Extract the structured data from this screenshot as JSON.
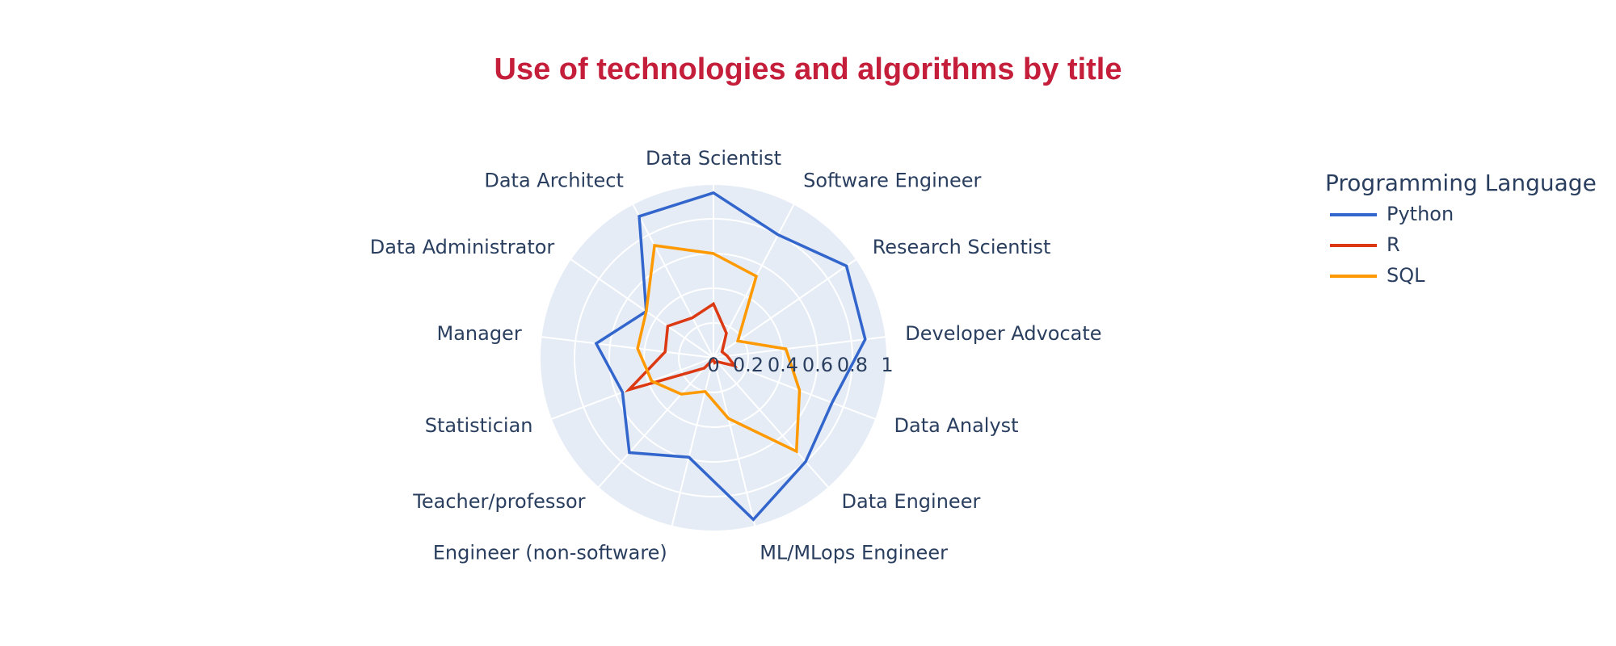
{
  "chart_data": {
    "type": "radar",
    "title": "Use of technologies and algorithms by title",
    "title_color": "#c41e3a",
    "categories": [
      "Data Scientist",
      "Software Engineer",
      "Research Scientist",
      "Developer Advocate",
      "Data Analyst",
      "Data Engineer",
      "ML/MLops Engineer",
      "Engineer (non-software)",
      "Teacher/professor",
      "Statistician",
      "Manager",
      "Data Administrator",
      "Data Architect"
    ],
    "radial_ticks": [
      "0",
      "0.2",
      "0.4",
      "0.6",
      "0.8",
      "1"
    ],
    "radial_range": [
      0,
      1
    ],
    "grid": true,
    "polar_bg_color": "#e5ecf6",
    "grid_color": "#ffffff",
    "legend": {
      "title": "Programming Language",
      "position": "top-right"
    },
    "series": [
      {
        "name": "Python",
        "color": "#3366cc",
        "values": [
          0.95,
          0.8,
          0.93,
          0.88,
          0.73,
          0.8,
          0.96,
          0.59,
          0.73,
          0.56,
          0.68,
          0.47,
          0.92
        ]
      },
      {
        "name": "R",
        "color": "#dc3912",
        "values": [
          0.31,
          0.16,
          0.06,
          0.08,
          0.13,
          0.03,
          0.03,
          0.01,
          0.08,
          0.52,
          0.28,
          0.32,
          0.26
        ]
      },
      {
        "name": "SQL",
        "color": "#ff9900",
        "values": [
          0.6,
          0.53,
          0.17,
          0.42,
          0.53,
          0.72,
          0.36,
          0.2,
          0.28,
          0.38,
          0.44,
          0.47,
          0.73
        ]
      }
    ]
  }
}
